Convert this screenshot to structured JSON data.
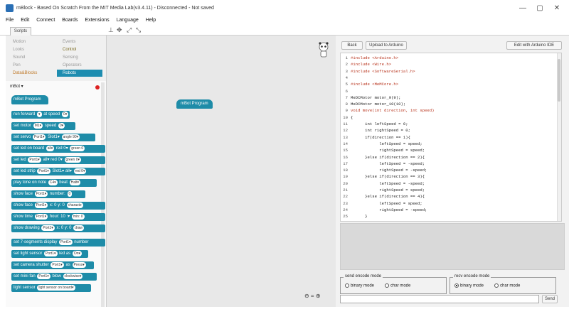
{
  "window": {
    "title": "mBlock - Based On Scratch From the MIT Media Lab(v3.4.11) - Disconnected - Not saved",
    "controls": [
      "—",
      "▢",
      "✕"
    ]
  },
  "menu": [
    "File",
    "Edit",
    "Connect",
    "Boards",
    "Extensions",
    "Language",
    "Help"
  ],
  "tabs": {
    "scripts": "Scripts"
  },
  "categories_left": [
    "Motion",
    "Looks",
    "Sound",
    "Pen",
    "Data&Blocks"
  ],
  "categories_right": [
    "Events",
    "Control",
    "Sensing",
    "Operators",
    "Robots"
  ],
  "palette": {
    "device": "mBot",
    "hat": "mBot Program",
    "blocks": [
      {
        "text": "run forward",
        "p1": "▾",
        "mid": "at speed",
        "p2": "0▾"
      },
      {
        "text": "set motor",
        "p1": "M1▾",
        "mid": "speed",
        "p2": "0▾"
      },
      {
        "text": "set servo",
        "p1": "Port1▾",
        "mid": "Slot1▾",
        "p2": "angle 90▾"
      },
      {
        "text": "set led on board",
        "p1": "all▾",
        "mid": "red 0▾",
        "p2": "green 0"
      },
      {
        "text": "set led",
        "p1": "Port1▾",
        "mid": "all▾ red 0▾",
        "p2": "green 0▾"
      },
      {
        "text": "set led strip",
        "p1": "Port1▾",
        "mid": "Slot1▾ all▾",
        "p2": "red 0▾"
      },
      {
        "text": "play tone on note",
        "p1": "C4▾",
        "mid": "beat",
        "p2": "Half▾"
      },
      {
        "text": "show face",
        "p1": "Port1▾",
        "mid": "number:",
        "p2": "0"
      },
      {
        "text": "show face",
        "p1": "Port1▾",
        "mid": "x: 0 y: 0",
        "p2": "characte"
      },
      {
        "text": "show time",
        "p1": "Port1▾",
        "mid": "hour: 10 :▾",
        "p2": "min: 0"
      },
      {
        "text": "show drawing",
        "p1": "Port1▾",
        "mid": "x: 0 y: 0",
        "p2": "draw"
      },
      {
        "text": "set 7-segments display",
        "p1": "Port1▾",
        "mid": "number",
        "p2": ""
      },
      {
        "text": "set light sensor",
        "p1": "Port1▾",
        "mid": "led as",
        "p2": "On▾"
      },
      {
        "text": "set camera shutter",
        "p1": "Port1▾",
        "mid": "as",
        "p2": "Press▾"
      },
      {
        "text": "set mini fan",
        "p1": "Port1▾",
        "mid": "blow",
        "p2": "clockwise▾"
      },
      {
        "text": "light sensor",
        "p1": "light sensor on board▾",
        "mid": "",
        "p2": ""
      }
    ]
  },
  "script_area": {
    "program_block": "mBot Program",
    "zoom": "⊖ = ⊕"
  },
  "code_panel": {
    "back": "Back",
    "upload": "Upload to Arduino",
    "edit_ide": "Edit with Arduino IDE",
    "lines": [
      "#include <Arduino.h>",
      "#include <Wire.h>",
      "#include <SoftwareSerial.h>",
      "",
      "#include <MeMCore.h>",
      "",
      "MeDCMotor motor_9(9);",
      "MeDCMotor motor_10(10);",
      "void move(int direction, int speed)",
      "{",
      "      int leftSpeed = 0;",
      "      int rightSpeed = 0;",
      "      if(direction == 1){",
      "            leftSpeed = speed;",
      "            rightSpeed = speed;",
      "      }else if(direction == 2){",
      "            leftSpeed = -speed;",
      "            rightSpeed = -speed;",
      "      }else if(direction == 3){",
      "            leftSpeed = -speed;",
      "            rightSpeed = speed;",
      "      }else if(direction == 4){",
      "            leftSpeed = speed;",
      "            rightSpeed = -speed;",
      "      }"
    ],
    "send_mode": "send encode mode",
    "recv_mode": "recv encode mode",
    "binary": "binary mode",
    "char": "char mode",
    "send": "Send"
  }
}
